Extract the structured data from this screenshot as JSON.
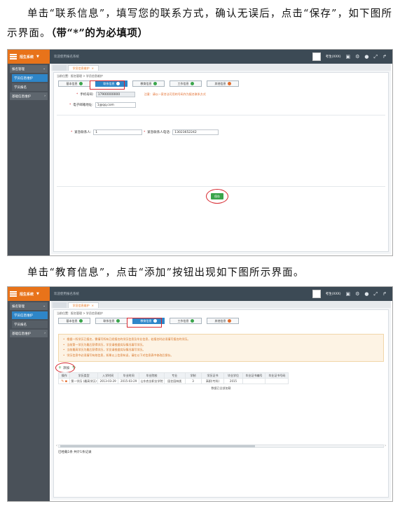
{
  "para1": {
    "text": "单击“联系信息”，填写您的联系方式，确认无误后，点击“保存”，如下图所示界面。",
    "bold": "（带“*”的为必填项）"
  },
  "para2": {
    "text": "单击“教育信息”，点击“添加”按钮出现如下图所示界面。"
  },
  "app": {
    "logo": "招生系统",
    "crumb": "欢迎使用报名系统",
    "user": "考生(XXX)",
    "sidebar": [
      {
        "label": "报名管理",
        "level": "top",
        "active": false
      },
      {
        "label": "学员信息维护",
        "level": "sub",
        "active": true
      },
      {
        "label": "学员报名",
        "level": "sub",
        "active": false
      },
      {
        "label": "基础信息维护",
        "level": "top",
        "active": false
      }
    ],
    "page_tab": "学员信息维护",
    "inner_crumb": "当前位置：报名管理 > 学员信息维护",
    "step_tabs": [
      "基本信息",
      "联系信息",
      "教育信息",
      "工作信息",
      "其他信息"
    ]
  },
  "shot1": {
    "mobile_label": "手机号码:",
    "mobile_value": "17900000000",
    "mobile_hint": "注意：请以一家合法可用的号码作为报名联系方式",
    "email_label": "电子邮箱地址:",
    "email_value": "1@qq.com",
    "contact_label": "紧急联系人:",
    "contact_value": "1",
    "contact_phone_label": "紧急联系人电话:",
    "contact_phone_value": "13023652242",
    "save_label": "保存"
  },
  "shot2": {
    "notices": [
      "根据一所学历已报名，需填写所有已经报名的学历信息及毕业信息，若报名时必须填写报名的学历。",
      "当前第一学历为最后获得学历，学员请根据实际情况填写学历。",
      "当前最高学历为最后获得学历，学员请根据实际情况填写学历。",
      "学历信息中必须填写有效信息，如果以上信息有误，请在以下对信息表中修改后保存。"
    ],
    "add_label": "添加",
    "headers": [
      "操作",
      "学历类型",
      "入学时间",
      "毕业时间",
      "毕业院校",
      "专业",
      "学制",
      "学历证书",
      "毕业学位",
      "毕业证书编号",
      "毕业证书号码"
    ],
    "rows": [
      [
        "",
        "第一学历 (最高学历)",
        "2013-03-29",
        "2015-03-29",
        "山东农业职业学院",
        "园艺园林类",
        "3",
        "高职(专科)",
        "2015",
        "",
        ""
      ]
    ],
    "footer_text": "数据已全部加载",
    "record_text": "已经载1条 共计1条记录"
  }
}
